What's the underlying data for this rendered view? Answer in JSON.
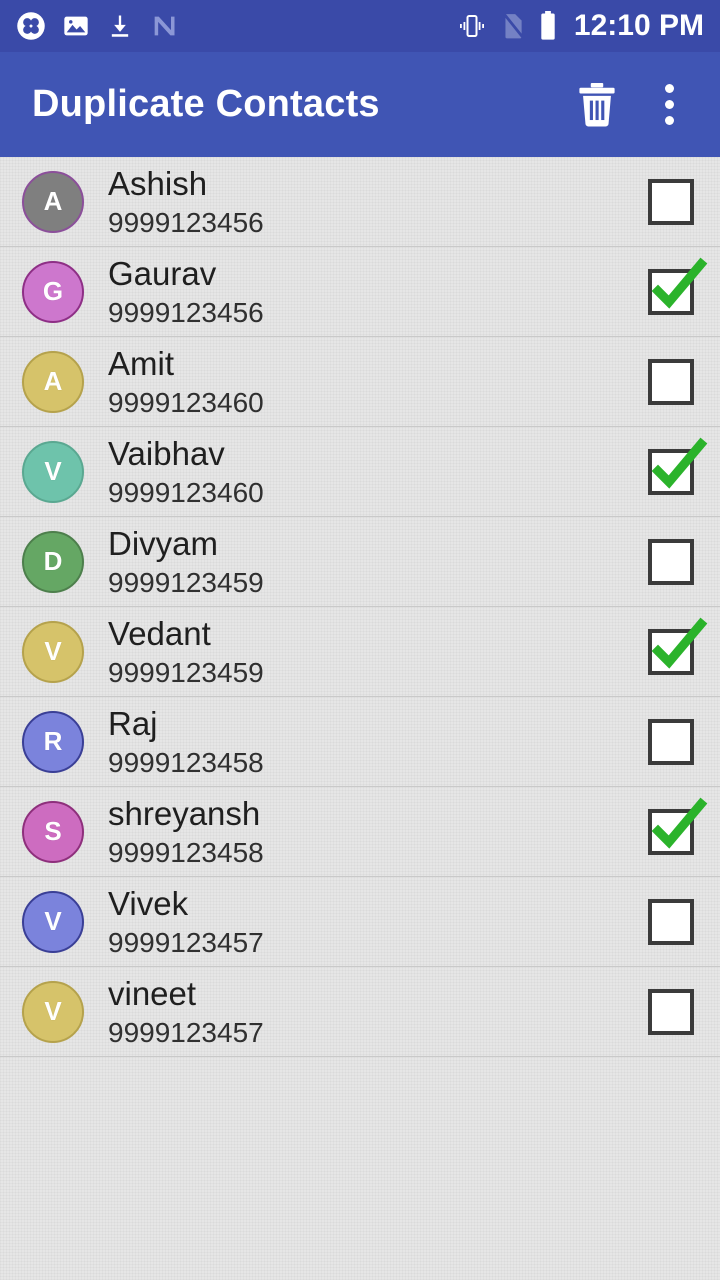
{
  "status_bar": {
    "background_color": "#3a4aa8",
    "time": "12:10 PM",
    "left_icons": [
      {
        "name": "clover-app-icon"
      },
      {
        "name": "image-gallery-icon"
      },
      {
        "name": "download-icon"
      },
      {
        "name": "nova-launcher-n-icon"
      }
    ],
    "right_icons": [
      {
        "name": "vibrate-mode-icon"
      },
      {
        "name": "no-sim-card-icon"
      },
      {
        "name": "battery-full-icon"
      }
    ]
  },
  "app_bar": {
    "background_color": "#4055b4",
    "title": "Duplicate Contacts",
    "delete_action_label": "Delete",
    "overflow_action_label": "More options"
  },
  "contacts": [
    {
      "name": "Ashish",
      "number": "9999123456",
      "initial": "A",
      "avatar_color": "#7f7f7f",
      "avatar_border": "#8b4f9a",
      "checked": false
    },
    {
      "name": "Gaurav",
      "number": "9999123456",
      "initial": "G",
      "avatar_color": "#cd77cd",
      "avatar_border": "#8e2f86",
      "checked": true
    },
    {
      "name": "Amit",
      "number": "9999123460",
      "initial": "A",
      "avatar_color": "#d6c36a",
      "avatar_border": "#b5a24c",
      "checked": false
    },
    {
      "name": "Vaibhav",
      "number": "9999123460",
      "initial": "V",
      "avatar_color": "#6ec3ab",
      "avatar_border": "#5aa891",
      "checked": true
    },
    {
      "name": "Divyam",
      "number": "9999123459",
      "initial": "D",
      "avatar_color": "#65a764",
      "avatar_border": "#4d7f4c",
      "checked": false
    },
    {
      "name": "Vedant",
      "number": "9999123459",
      "initial": "V",
      "avatar_color": "#d6c36a",
      "avatar_border": "#b5a24c",
      "checked": true
    },
    {
      "name": "Raj",
      "number": "9999123458",
      "initial": "R",
      "avatar_color": "#7b83dc",
      "avatar_border": "#3a3f96",
      "checked": false
    },
    {
      "name": "shreyansh",
      "number": "9999123458",
      "initial": "S",
      "avatar_color": "#cd6cc0",
      "avatar_border": "#8e2f7c",
      "checked": true
    },
    {
      "name": "Vivek",
      "number": "9999123457",
      "initial": "V",
      "avatar_color": "#7b83dc",
      "avatar_border": "#3a3f96",
      "checked": false
    },
    {
      "name": "vineet",
      "number": "9999123457",
      "initial": "V",
      "avatar_color": "#d6c36a",
      "avatar_border": "#b5a24c",
      "checked": false
    }
  ],
  "theme": {
    "checkmark_color": "#2bb32b",
    "checkbox_border_color": "#3b3b3b",
    "list_background": "#e4e4e4",
    "divider_color": "#c9c9c9",
    "name_text_color": "#1f1f1f",
    "number_text_color": "#303030"
  },
  "icons": {
    "delete": "trash-icon",
    "overflow": "overflow-menu-icon",
    "checkbox_checked": "checkbox-checked-icon",
    "checkbox_unchecked": "checkbox-unchecked-icon"
  }
}
